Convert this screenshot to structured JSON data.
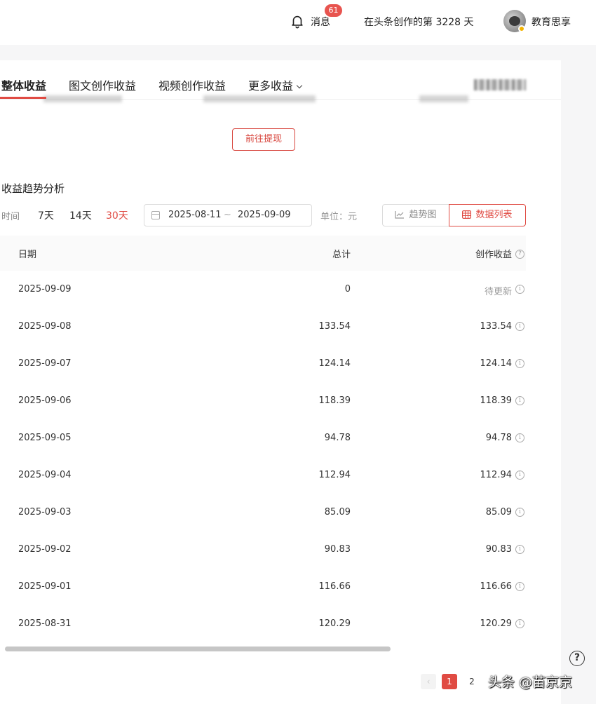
{
  "header": {
    "messages_label": "消息",
    "messages_badge": "61",
    "days_text": "在头条创作的第 3228 天",
    "user_name": "教育思享"
  },
  "tabs": [
    {
      "label": "整体收益"
    },
    {
      "label": "图文创作收益"
    },
    {
      "label": "视频创作收益"
    },
    {
      "label": "更多收益"
    }
  ],
  "withdraw_label": "前往提现",
  "section_title": "收益趋势分析",
  "filters": {
    "label": "时间",
    "ranges": [
      "7天",
      "14天",
      "30天"
    ],
    "active_range": "30天",
    "start_date": "2025-08-11",
    "separator": "~",
    "end_date": "2025-09-09",
    "unit": "单位：元"
  },
  "view_toggle": {
    "trend": "趋势图",
    "table": "数据列表"
  },
  "table": {
    "columns": [
      "日期",
      "总计",
      "创作收益"
    ],
    "rows": [
      {
        "date": "2025-09-09",
        "total": "0",
        "income": "待更新"
      },
      {
        "date": "2025-09-08",
        "total": "133.54",
        "income": "133.54"
      },
      {
        "date": "2025-09-07",
        "total": "124.14",
        "income": "124.14"
      },
      {
        "date": "2025-09-06",
        "total": "118.39",
        "income": "118.39"
      },
      {
        "date": "2025-09-05",
        "total": "94.78",
        "income": "94.78"
      },
      {
        "date": "2025-09-04",
        "total": "112.94",
        "income": "112.94"
      },
      {
        "date": "2025-09-03",
        "total": "85.09",
        "income": "85.09"
      },
      {
        "date": "2025-09-02",
        "total": "90.83",
        "income": "90.83"
      },
      {
        "date": "2025-09-01",
        "total": "116.66",
        "income": "116.66"
      },
      {
        "date": "2025-08-31",
        "total": "120.29",
        "income": "120.29"
      }
    ]
  },
  "pagination": {
    "pages": [
      "1",
      "2"
    ],
    "current": "1"
  },
  "help_glyph": "?",
  "watermark": "头条 @苗京京",
  "colors": {
    "accent": "#e04b43",
    "badge": "#e8544f"
  }
}
